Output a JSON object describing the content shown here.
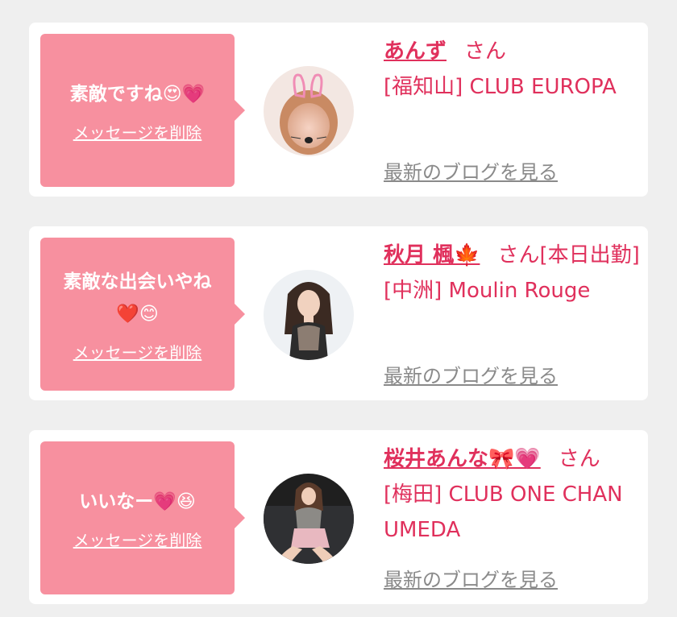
{
  "messages": [
    {
      "text": "素敵ですね😍💗",
      "delete_label": "メッセージを削除",
      "name": "あんず",
      "honorific": "さん",
      "store": "[福知山] CLUB EUROPA",
      "blog_link": "最新のブログを見る"
    },
    {
      "text": "素敵な出会いやね❤️😊",
      "delete_label": "メッセージを削除",
      "name": "秋月 楓🍁",
      "honorific": "さん[本日出勤]",
      "store": "[中洲] Moulin Rouge",
      "blog_link": "最新のブログを見る"
    },
    {
      "text": "いいなー💗😆",
      "delete_label": "メッセージを削除",
      "name": "桜井あんな🎀💗",
      "honorific": "さん",
      "store": "[梅田] CLUB ONE CHAN UMEDA",
      "blog_link": "最新のブログを見る"
    }
  ],
  "colors": {
    "bubble": "#f7909f",
    "accent": "#e0305c",
    "link_gray": "#8a8a8a",
    "background": "#efefef"
  }
}
